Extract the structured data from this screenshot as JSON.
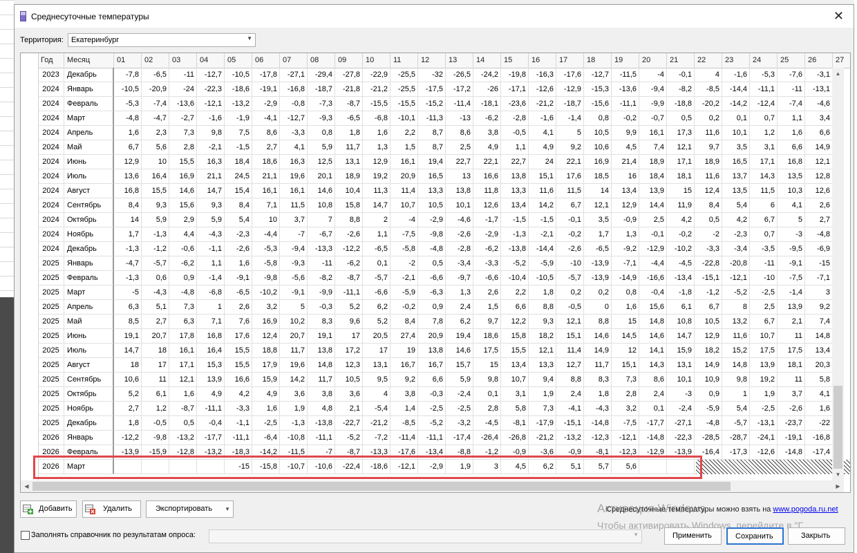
{
  "window": {
    "title": "Среднесуточные температуры",
    "close": "✕"
  },
  "territory": {
    "label": "Территория:",
    "value": "Екатеринбург"
  },
  "table": {
    "columns": [
      "Год",
      "Месяц",
      "01",
      "02",
      "03",
      "04",
      "05",
      "06",
      "07",
      "08",
      "09",
      "10",
      "11",
      "12",
      "13",
      "14",
      "15",
      "16",
      "17",
      "18",
      "19",
      "20",
      "21",
      "22",
      "23",
      "24",
      "25",
      "26",
      "27"
    ],
    "rows": [
      [
        "2023",
        "Декабрь",
        "-7,8",
        "-6,5",
        "-11",
        "-12,7",
        "-10,5",
        "-17,8",
        "-27,1",
        "-29,4",
        "-27,8",
        "-22,9",
        "-25,5",
        "-32",
        "-26,5",
        "-24,2",
        "-19,8",
        "-16,3",
        "-17,6",
        "-12,7",
        "-11,5",
        "-4",
        "-0,1",
        "4",
        "-1,6",
        "-5,3",
        "-7,6",
        "-3,1"
      ],
      [
        "2024",
        "Январь",
        "-10,5",
        "-20,9",
        "-24",
        "-22,3",
        "-18,6",
        "-19,1",
        "-16,8",
        "-18,7",
        "-21,8",
        "-21,2",
        "-25,5",
        "-17,5",
        "-17,2",
        "-26",
        "-17,1",
        "-12,6",
        "-12,9",
        "-15,3",
        "-13,6",
        "-9,4",
        "-8,2",
        "-8,5",
        "-14,4",
        "-11,1",
        "-11",
        "-13,1"
      ],
      [
        "2024",
        "Февраль",
        "-5,3",
        "-7,4",
        "-13,6",
        "-12,1",
        "-13,2",
        "-2,9",
        "-0,8",
        "-7,3",
        "-8,7",
        "-15,5",
        "-15,5",
        "-15,2",
        "-11,4",
        "-18,1",
        "-23,6",
        "-21,2",
        "-18,7",
        "-15,6",
        "-11,1",
        "-9,9",
        "-18,8",
        "-20,2",
        "-14,2",
        "-12,4",
        "-7,4",
        "-4,6"
      ],
      [
        "2024",
        "Март",
        "-4,8",
        "-4,7",
        "-2,7",
        "-1,6",
        "-1,9",
        "-4,1",
        "-12,7",
        "-9,3",
        "-6,5",
        "-6,8",
        "-10,1",
        "-11,3",
        "-13",
        "-6,2",
        "-2,8",
        "-1,6",
        "-1,4",
        "0,8",
        "-0,2",
        "-0,7",
        "0,5",
        "0,2",
        "0,1",
        "0,7",
        "1,1",
        "3,4"
      ],
      [
        "2024",
        "Апрель",
        "1,6",
        "2,3",
        "7,3",
        "9,8",
        "7,5",
        "8,6",
        "-3,3",
        "0,8",
        "1,8",
        "1,6",
        "2,2",
        "8,7",
        "8,6",
        "3,8",
        "-0,5",
        "4,1",
        "5",
        "10,5",
        "9,9",
        "16,1",
        "17,3",
        "11,6",
        "10,1",
        "1,2",
        "1,6",
        "6,6"
      ],
      [
        "2024",
        "Май",
        "6,7",
        "5,6",
        "2,8",
        "-2,1",
        "-1,5",
        "2,7",
        "4,1",
        "5,9",
        "11,7",
        "1,3",
        "1,5",
        "8,7",
        "2,5",
        "4,9",
        "1,1",
        "4,9",
        "9,2",
        "10,6",
        "4,5",
        "7,4",
        "12,1",
        "9,7",
        "3,5",
        "3,1",
        "6,6",
        "14,9"
      ],
      [
        "2024",
        "Июнь",
        "12,9",
        "10",
        "15,5",
        "16,3",
        "18,4",
        "18,6",
        "16,3",
        "12,5",
        "13,1",
        "12,9",
        "16,1",
        "19,4",
        "22,7",
        "22,1",
        "22,7",
        "24",
        "22,1",
        "16,9",
        "21,4",
        "18,9",
        "17,1",
        "18,9",
        "16,5",
        "17,1",
        "16,8",
        "12,1"
      ],
      [
        "2024",
        "Июль",
        "13,6",
        "16,4",
        "16,9",
        "21,1",
        "24,5",
        "21,1",
        "19,6",
        "20,1",
        "18,9",
        "19,2",
        "20,9",
        "16,5",
        "13",
        "16,6",
        "13,8",
        "15,1",
        "17,6",
        "18,5",
        "16",
        "18,4",
        "18,1",
        "11,6",
        "13,7",
        "14,3",
        "13,5",
        "12,8"
      ],
      [
        "2024",
        "Август",
        "16,8",
        "15,5",
        "14,6",
        "14,7",
        "15,4",
        "16,1",
        "16,1",
        "14,6",
        "10,4",
        "11,3",
        "11,4",
        "13,3",
        "13,8",
        "11,8",
        "13,3",
        "11,6",
        "11,5",
        "14",
        "13,4",
        "13,9",
        "15",
        "12,4",
        "13,5",
        "11,5",
        "10,3",
        "12,6"
      ],
      [
        "2024",
        "Сентябрь",
        "8,4",
        "9,3",
        "15,6",
        "9,3",
        "8,4",
        "7,1",
        "11,5",
        "10,8",
        "15,8",
        "14,7",
        "10,7",
        "10,5",
        "10,1",
        "12,6",
        "13,4",
        "14,2",
        "6,7",
        "12,1",
        "12,9",
        "14,4",
        "11,9",
        "8,4",
        "5,4",
        "6",
        "4,1",
        "2,6"
      ],
      [
        "2024",
        "Октябрь",
        "14",
        "5,9",
        "2,9",
        "5,9",
        "5,4",
        "10",
        "3,7",
        "7",
        "8,8",
        "2",
        "-4",
        "-2,9",
        "-4,6",
        "-1,7",
        "-1,5",
        "-1,5",
        "-0,1",
        "3,5",
        "-0,9",
        "2,5",
        "4,2",
        "0,5",
        "4,2",
        "6,7",
        "5",
        "2,7"
      ],
      [
        "2024",
        "Ноябрь",
        "1,7",
        "-1,3",
        "4,4",
        "-4,3",
        "-2,3",
        "-4,4",
        "-7",
        "-6,7",
        "-2,6",
        "1,1",
        "-7,5",
        "-9,8",
        "-2,6",
        "-2,9",
        "-1,3",
        "-2,1",
        "-0,2",
        "1,7",
        "1,3",
        "-0,1",
        "-0,2",
        "-2",
        "-2,3",
        "0,7",
        "-3",
        "-4,8"
      ],
      [
        "2024",
        "Декабрь",
        "-1,3",
        "-1,2",
        "-0,6",
        "-1,1",
        "-2,6",
        "-5,3",
        "-9,4",
        "-13,3",
        "-12,2",
        "-6,5",
        "-5,8",
        "-4,8",
        "-2,8",
        "-6,2",
        "-13,8",
        "-14,4",
        "-2,6",
        "-6,5",
        "-9,2",
        "-12,9",
        "-10,2",
        "-3,3",
        "-3,4",
        "-3,5",
        "-9,5",
        "-6,9"
      ],
      [
        "2025",
        "Январь",
        "-4,7",
        "-5,7",
        "-6,2",
        "1,1",
        "1,6",
        "-5,8",
        "-9,3",
        "-11",
        "-6,2",
        "0,1",
        "-2",
        "0,5",
        "-3,4",
        "-3,3",
        "-5,2",
        "-5,9",
        "-10",
        "-13,9",
        "-7,1",
        "-4,4",
        "-4,5",
        "-22,8",
        "-20,8",
        "-11",
        "-9,1",
        "-15"
      ],
      [
        "2025",
        "Февраль",
        "-1,3",
        "0,6",
        "0,9",
        "-1,4",
        "-9,1",
        "-9,8",
        "-5,6",
        "-8,2",
        "-8,7",
        "-5,7",
        "-2,1",
        "-6,6",
        "-9,7",
        "-6,6",
        "-10,4",
        "-10,5",
        "-5,7",
        "-13,9",
        "-14,9",
        "-16,6",
        "-13,4",
        "-15,1",
        "-12,1",
        "-10",
        "-7,5",
        "-7,1"
      ],
      [
        "2025",
        "Март",
        "-5",
        "-4,3",
        "-4,8",
        "-6,8",
        "-6,5",
        "-10,2",
        "-9,1",
        "-9,9",
        "-11,1",
        "-6,6",
        "-5,9",
        "-6,3",
        "1,3",
        "2,6",
        "2,2",
        "1,8",
        "0,2",
        "0,2",
        "0,8",
        "-0,4",
        "-1,8",
        "-1,2",
        "-5,2",
        "-2,5",
        "-1,4",
        "3"
      ],
      [
        "2025",
        "Апрель",
        "6,3",
        "5,1",
        "7,3",
        "1",
        "2,6",
        "3,2",
        "5",
        "-0,3",
        "5,2",
        "6,2",
        "-0,2",
        "0,9",
        "2,4",
        "1,5",
        "6,6",
        "8,8",
        "-0,5",
        "0",
        "1,6",
        "15,6",
        "6,1",
        "6,7",
        "8",
        "2,5",
        "13,9",
        "9,2"
      ],
      [
        "2025",
        "Май",
        "8,5",
        "2,7",
        "6,3",
        "7,1",
        "7,6",
        "16,9",
        "10,2",
        "8,3",
        "9,6",
        "5,2",
        "8,4",
        "7,8",
        "6,2",
        "9,7",
        "12,2",
        "9,3",
        "12,1",
        "8,8",
        "15",
        "14,8",
        "10,8",
        "10,5",
        "13,2",
        "6,7",
        "2,1",
        "7,4"
      ],
      [
        "2025",
        "Июнь",
        "19,1",
        "20,7",
        "17,8",
        "16,8",
        "17,6",
        "12,4",
        "20,7",
        "19,1",
        "17",
        "20,5",
        "27,4",
        "20,9",
        "19,4",
        "18,6",
        "15,8",
        "18,2",
        "15,1",
        "14,6",
        "14,5",
        "14,6",
        "14,7",
        "12,9",
        "11,6",
        "10,7",
        "11",
        "14,8"
      ],
      [
        "2025",
        "Июль",
        "14,7",
        "18",
        "16,1",
        "16,4",
        "15,5",
        "18,8",
        "11,7",
        "13,8",
        "17,2",
        "17",
        "19",
        "13,8",
        "14,6",
        "17,5",
        "15,5",
        "12,1",
        "11,4",
        "14,9",
        "12",
        "14,1",
        "15,9",
        "18,2",
        "15,2",
        "17,5",
        "17,5",
        "13,4"
      ],
      [
        "2025",
        "Август",
        "18",
        "17",
        "17,1",
        "15,3",
        "15,5",
        "17,9",
        "19,6",
        "14,8",
        "12,3",
        "13,1",
        "16,7",
        "16,7",
        "15,7",
        "15",
        "13,4",
        "13,3",
        "12,7",
        "11,7",
        "15,1",
        "14,3",
        "13,1",
        "14,9",
        "14,8",
        "13,9",
        "18,1",
        "20,3"
      ],
      [
        "2025",
        "Сентябрь",
        "10,6",
        "11",
        "12,1",
        "13,9",
        "16,6",
        "15,9",
        "14,2",
        "11,7",
        "10,5",
        "9,5",
        "9,2",
        "6,6",
        "5,9",
        "9,8",
        "10,7",
        "9,4",
        "8,8",
        "8,3",
        "7,3",
        "8,6",
        "10,1",
        "10,9",
        "9,8",
        "19,2",
        "11",
        "5,8"
      ],
      [
        "2025",
        "Октябрь",
        "5,2",
        "6,1",
        "1,6",
        "4,9",
        "4,2",
        "4,9",
        "3,6",
        "3,8",
        "3,6",
        "4",
        "3,8",
        "-0,3",
        "-2,4",
        "0,1",
        "3,1",
        "1,9",
        "2,4",
        "1,8",
        "2,8",
        "2,4",
        "-3",
        "0,9",
        "1",
        "1,9",
        "3,7",
        "4,1"
      ],
      [
        "2025",
        "Ноябрь",
        "2,7",
        "1,2",
        "-8,7",
        "-11,1",
        "-3,3",
        "1,6",
        "1,9",
        "4,8",
        "2,1",
        "-5,4",
        "1,4",
        "-2,5",
        "-2,5",
        "2,8",
        "5,8",
        "7,3",
        "-4,1",
        "-4,3",
        "3,2",
        "0,1",
        "-2,4",
        "-5,9",
        "5,4",
        "-2,5",
        "-2,6",
        "1,6"
      ],
      [
        "2025",
        "Декабрь",
        "1,8",
        "-0,5",
        "0,5",
        "-0,4",
        "-1,1",
        "-2,5",
        "-1,3",
        "-13,8",
        "-22,7",
        "-21,2",
        "-8,5",
        "-5,2",
        "-3,2",
        "-4,5",
        "-8,1",
        "-17,9",
        "-15,1",
        "-14,8",
        "-7,5",
        "-17,7",
        "-27,1",
        "-4,8",
        "-5,7",
        "-13,1",
        "-23,7",
        "-22"
      ],
      [
        "2026",
        "Январь",
        "-12,2",
        "-9,8",
        "-13,2",
        "-17,7",
        "-11,1",
        "-6,4",
        "-10,8",
        "-11,1",
        "-5,2",
        "-7,2",
        "-11,4",
        "-11,1",
        "-17,4",
        "-26,4",
        "-26,8",
        "-21,2",
        "-13,2",
        "-12,3",
        "-12,1",
        "-14,8",
        "-22,3",
        "-28,5",
        "-28,7",
        "-24,1",
        "-19,1",
        "-16,8"
      ],
      [
        "2026",
        "Февраль",
        "-13,9",
        "-15,9",
        "-12,8",
        "-13,2",
        "-18,3",
        "-14,2",
        "-11,5",
        "-7",
        "-8,7",
        "-13,3",
        "-17,6",
        "-13,4",
        "-8,8",
        "-1,2",
        "-0,9",
        "-3,6",
        "-0,9",
        "-8,1",
        "-12,3",
        "-12,9",
        "-13,9",
        "-16,4",
        "-17,3",
        "-12,6",
        "-14,8",
        "-17,4"
      ],
      [
        "2026",
        "Март",
        "",
        "",
        "",
        "",
        "-15",
        "-15,8",
        "-10,7",
        "-10,6",
        "-22,4",
        "-18,6",
        "-12,1",
        "-2,9",
        "1,9",
        "3",
        "4,5",
        "6,2",
        "5,1",
        "5,7",
        "5,6",
        "",
        "",
        "",
        "",
        "",
        "",
        ""
      ]
    ]
  },
  "buttons": {
    "add": "Добавить",
    "delete": "Удалить",
    "export": "Экспортировать",
    "apply": "Применить",
    "save": "Сохранить",
    "close": "Закрыть"
  },
  "info": {
    "text": "Среднесуточные температуры можно взять на",
    "link": "www.pogoda.ru.net"
  },
  "watermark": {
    "line1": "Активация Windows",
    "line2": "Чтобы активировать Windows, перейдите в \"Г"
  },
  "poll": {
    "label": "Заполнять справочник по результатам опроса:",
    "value": ""
  },
  "colors": {
    "accent": "#2a73cf",
    "highlight": "#e0474c",
    "link": "#0000ee"
  }
}
